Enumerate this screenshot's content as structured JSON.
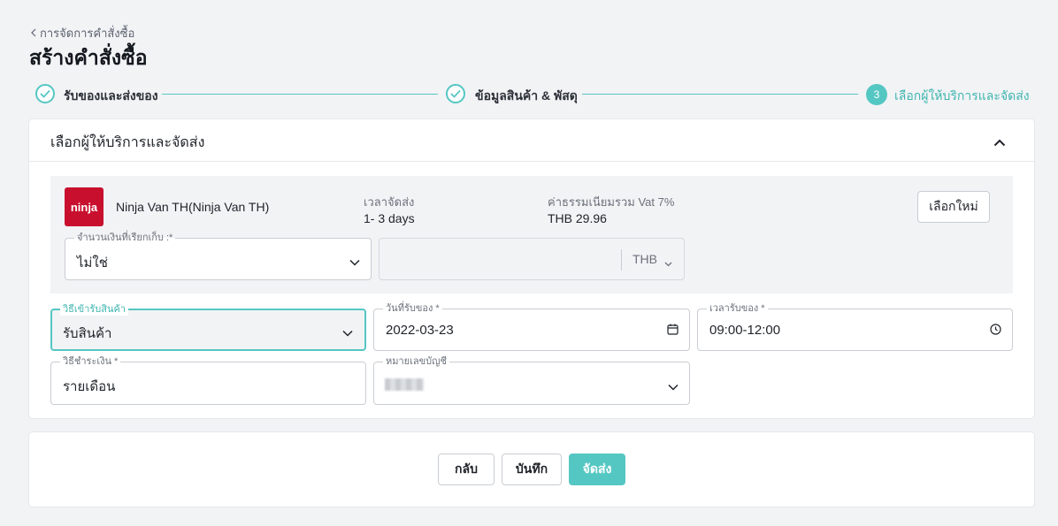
{
  "breadcrumb": {
    "label": "การจัดการคำสั่งซื้อ"
  },
  "page": {
    "title": "สร้างคำสั่งซื้อ"
  },
  "stepper": {
    "steps": [
      {
        "label": "รับของและส่งของ",
        "state": "done"
      },
      {
        "label": "ข้อมูลสินค้า & พัสดุ",
        "state": "done"
      },
      {
        "label": "เลือกผู้ให้บริการและจัดส่ง",
        "state": "active",
        "number": "3"
      }
    ]
  },
  "section": {
    "title": "เลือกผู้ให้บริการและจัดส่ง"
  },
  "provider": {
    "logo_text": "ninja",
    "name": "Ninja Van TH(Ninja Van TH)",
    "delivery_time_label": "เวลาจัดส่ง",
    "delivery_time_value": "1- 3 days",
    "fee_label": "ค่าธรรมเนียมรวม Vat 7%",
    "fee_value": "THB 29.96",
    "reselect_label": "เลือกใหม่"
  },
  "cod": {
    "label": "จำนวนเงินที่เรียกเก็บ :*",
    "value": "ไม่ใช่",
    "amount_placeholder": "",
    "currency": "THB"
  },
  "form": {
    "pickup_method": {
      "label": "วิธีเข้ารับสินค้า",
      "value": "รับสินค้า"
    },
    "pickup_date": {
      "label": "วันที่รับของ *",
      "value": "2022-03-23"
    },
    "pickup_time": {
      "label": "เวลารับของ *",
      "value": "09:00-12:00"
    },
    "payment_method": {
      "label": "วิธีชำระเงิน *",
      "value": "รายเดือน"
    },
    "account_number": {
      "label": "หมายเลขบัญชี"
    }
  },
  "actions": {
    "back": "กลับ",
    "save": "บันทึก",
    "ship": "จัดส่ง"
  },
  "colors": {
    "accent": "#55c7c3",
    "accent_text": "#3fb5b0",
    "logo_red": "#c8102e"
  }
}
